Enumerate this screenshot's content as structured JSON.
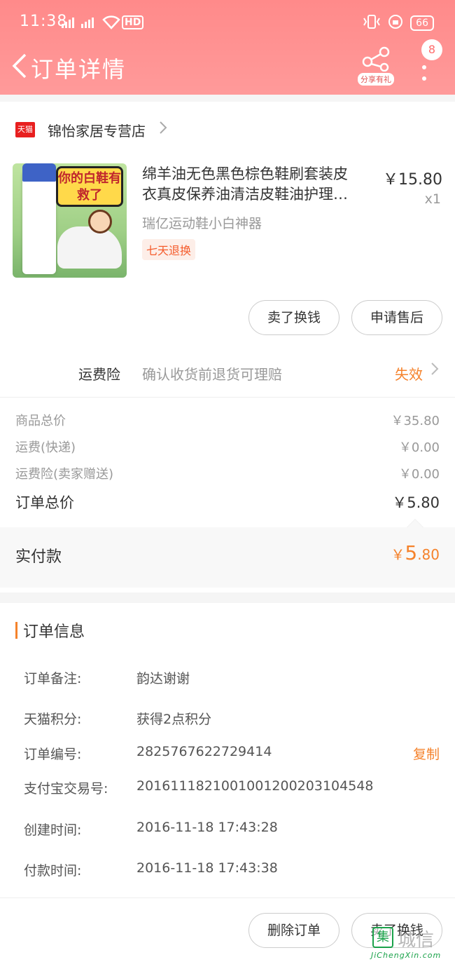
{
  "status_bar": {
    "time": "11:38",
    "signal": "4G 3G",
    "hd": "HD",
    "battery": "66"
  },
  "nav": {
    "title": "订单详情",
    "share_label": "分享有礼",
    "badge_count": "8"
  },
  "shop": {
    "logo_text": "天猫",
    "name": "锦怡家居专营店"
  },
  "product": {
    "title_line1": "绵羊油无色黑色棕色鞋刷套装皮",
    "title_line2": "衣真皮保养油清洁皮鞋油护理…",
    "sku": "瑞亿运动鞋小白神器",
    "tag": "七天退换",
    "price": "￥15.80",
    "qty": "x1",
    "image_caption": "你的白鞋有救了"
  },
  "item_actions": {
    "sell_label": "卖了换钱",
    "aftersale_label": "申请售后"
  },
  "insurance": {
    "label": "运费险",
    "desc": "确认收货前退货可理赔",
    "status": "失效"
  },
  "summary": {
    "rows": [
      {
        "label": "商品总价",
        "value": "￥35.80"
      },
      {
        "label": "运费(快递)",
        "value": "￥0.00"
      },
      {
        "label": "运费险(卖家赠送)",
        "value": "￥0.00"
      }
    ],
    "total_label": "订单总价",
    "total_value": "￥5.80"
  },
  "paid": {
    "label": "实付款",
    "currency": "￥",
    "integer": "5",
    "decimal": ".80"
  },
  "order_info": {
    "title": "订单信息",
    "rows": [
      {
        "label": "订单备注:",
        "value": "韵达谢谢"
      },
      {
        "label": "天猫积分:",
        "value": "获得2点积分"
      },
      {
        "label": "订单编号:",
        "value": "2825767622729414"
      },
      {
        "label": "支付宝交易号:",
        "value": "2016111821001001200203104548"
      },
      {
        "label": "创建时间:",
        "value": "2016-11-18 17:43:28"
      },
      {
        "label": "付款时间:",
        "value": "2016-11-18 17:43:38"
      }
    ],
    "copy_label": "复制"
  },
  "footer": {
    "delete_label": "删除订单",
    "sell_label": "卖了换钱"
  },
  "watermark": {
    "icon": "集",
    "text": "城信",
    "sub": "JiChengXin.com"
  },
  "colors": {
    "header": "#ff8a8a",
    "accent": "#f5822b",
    "tmall": "#e81f1f"
  }
}
